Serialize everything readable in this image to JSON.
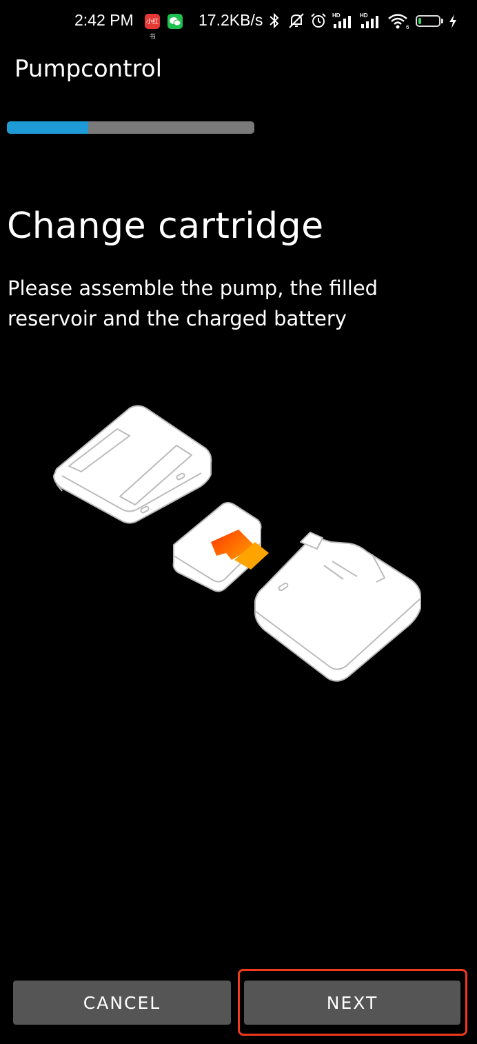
{
  "status_bar": {
    "time": "2:42 PM",
    "notification_badges": [
      {
        "name": "app-notification-icon",
        "label": "小红书",
        "color": "#e53935"
      },
      {
        "name": "wechat-icon",
        "label": "",
        "color": "#1fbf4f"
      }
    ],
    "network_rate": "17.2KB/s",
    "icons": [
      "bluetooth-icon",
      "mute-bell-icon",
      "alarm-icon",
      "hd-signal-icon",
      "hd-signal-icon",
      "wifi-icon"
    ],
    "battery_level": "12",
    "battery_charging": true
  },
  "app": {
    "title": "Pumpcontrol"
  },
  "progress": {
    "value_fraction": 0.33,
    "fill_color": "#1e9ad6",
    "track_color": "#7a7a7a"
  },
  "content": {
    "heading": "Change cartridge",
    "description": "Please assemble the pump, the filled reservoir and the charged battery",
    "illustration": "pump-reservoir-battery-assembly-image"
  },
  "actions": {
    "cancel_label": "CANCEL",
    "next_label": "NEXT"
  }
}
